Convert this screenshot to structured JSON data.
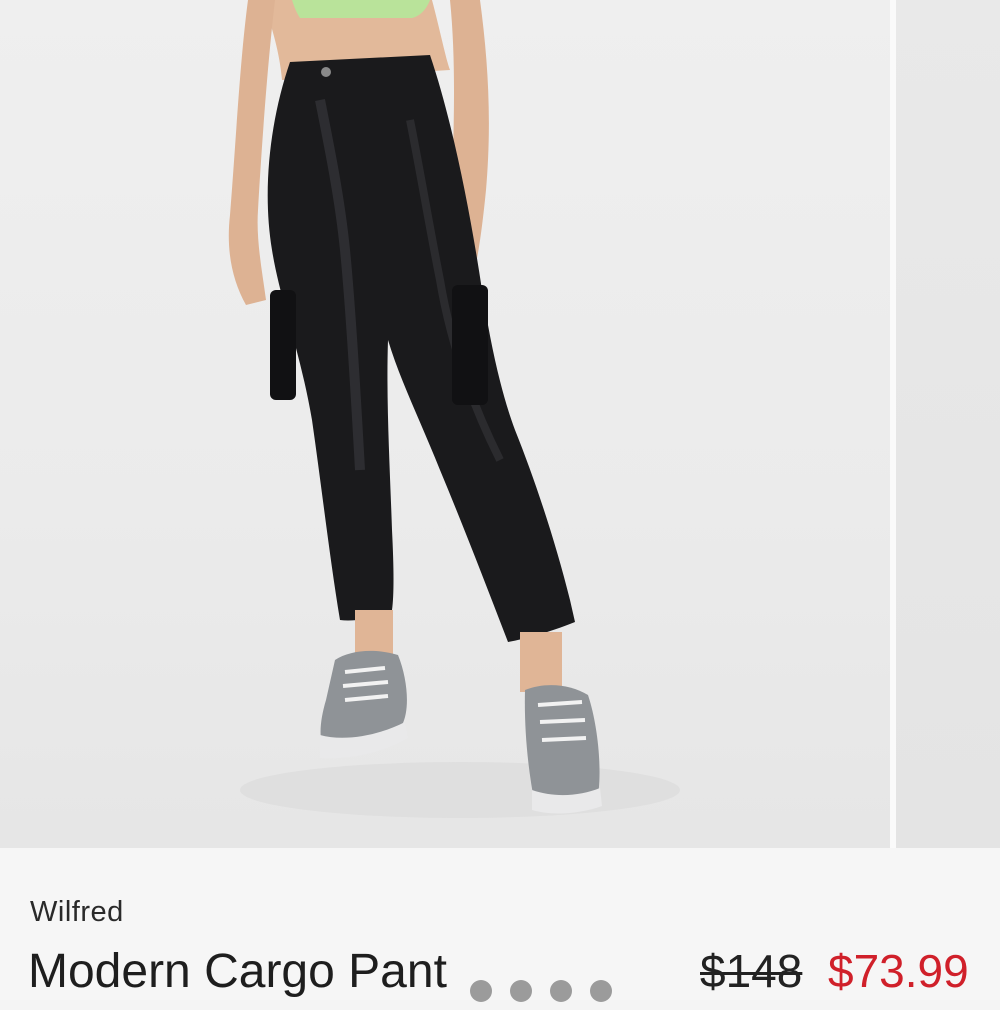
{
  "product": {
    "brand": "Wilfred",
    "title": "Modern Cargo Pant",
    "price_original": "$148",
    "price_sale": "$73.99"
  },
  "gallery": {
    "slide_count_visible_dots": 4,
    "current_slide": 1,
    "image_subject": "model wearing black faux-leather cargo pants, green crop top and grey running sneakers"
  },
  "colors": {
    "sale_price": "#d0202a",
    "pants": "#1a1a1c",
    "crop_top": "#b9e39a",
    "background": "#ececec"
  }
}
